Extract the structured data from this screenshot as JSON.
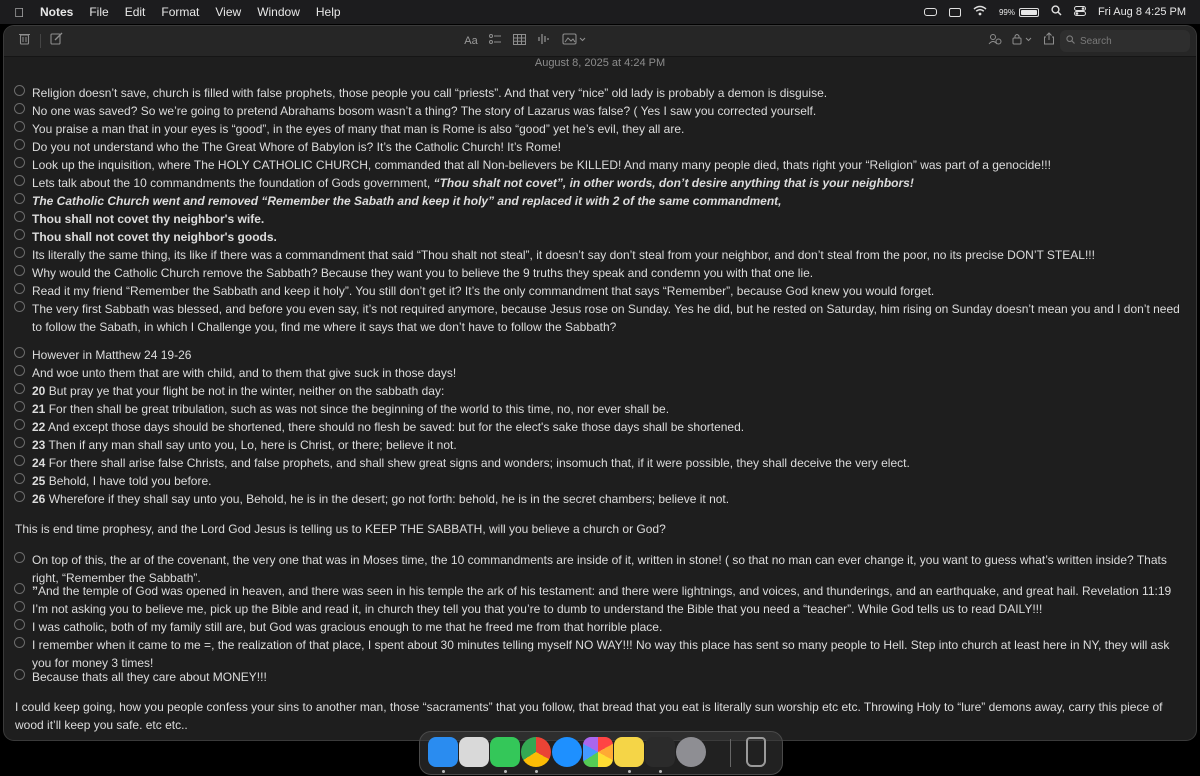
{
  "menubar": {
    "app_name": "Notes",
    "menus": [
      "File",
      "Edit",
      "Format",
      "View",
      "Window",
      "Help"
    ],
    "battery": "99%",
    "battery_level": 0.99,
    "datetime": "Fri Aug 8  4:25 PM",
    "icons": [
      "apple-icon",
      "mirror-icon",
      "screen-icon",
      "wifi-icon",
      "battery-icon",
      "spotlight-icon",
      "control-center-icon"
    ]
  },
  "toolbar": {
    "icons_left": [
      "trash-icon",
      "compose-icon"
    ],
    "icons_center": [
      "format-text-icon",
      "checklist-icon",
      "table-icon",
      "audio-icon",
      "media-icon"
    ],
    "icons_right": [
      "collaborate-icon",
      "lock-icon",
      "share-icon"
    ],
    "format_label": "Aa",
    "search_placeholder": "Search"
  },
  "note": {
    "date": "August 8, 2025 at 4:24 PM",
    "group1": [
      "Religion doesn’t save, church is filled with false prophets, those people you call “priests”. And that very “nice” old lady is probably a demon is disguise.",
      "No one was saved? So we’re going to pretend Abrahams bosom wasn’t a thing? The story of Lazarus was false? ( Yes I saw you corrected yourself.",
      "You praise a man that in your eyes is “good”, in the eyes of many that man is Rome is also “good” yet he’s evil, they all are.",
      "Do you not understand who the The Great Whore of Babylon is? It’s the Catholic Church! It’s Rome!",
      "Look up the inquisition, where The HOLY CATHOLIC CHURCH, commanded that all Non-believers be KILLED! And many many people died, thats right your “Religion” was part of a genocide!!!",
      {
        "plain": "Lets talk about the 10 commandments the foundation of Gods government, ",
        "emph": "“Thou shalt not covet”, in other words, don’t desire anything that is your neighbors!"
      },
      {
        "emph": "The Catholic Church went and removed “Remember the Sabath and keep it holy” and replaced it with 2 of the same commandment,"
      },
      {
        "bold": "Thou shall not covet thy neighbor's wife."
      },
      {
        "bold": "Thou shall not covet thy neighbor's goods."
      },
      "Its literally the same thing, its like if there was a commandment that said “Thou shalt not steal”, it doesn’t say don’t steal from your neighbor, and don’t steal from the poor, no its precise DON’T STEAL!!!",
      "Why would the Catholic Church remove the Sabbath? Because they want you to believe the 9 truths they speak and condemn you with that one lie.",
      "Read it my friend “Remember the Sabbath and keep it holy”. You still don’t get it? It’s the only commandment that says “Remember”, because God knew you would forget.",
      "The very first Sabbath was blessed, and before you even say, it’s not required anymore, because Jesus rose on Sunday. Yes he did, but he rested on Saturday, him rising on Sunday doesn’t mean you and I don’t need to follow the Sabath, in which I Challenge you, find me where it says that we don’t have to follow the Sabbath?"
    ],
    "group2": [
      {
        "text": "However in Matthew 24 19-26"
      },
      {
        "text": "And woe unto them that are with child, and to them that give suck in those days!"
      },
      {
        "num": "20",
        "text": " But pray ye that your flight be not in the winter, neither on the sabbath day:"
      },
      {
        "num": "21",
        "text": " For then shall be great tribulation, such as was not since the beginning of the world to this time, no, nor ever shall be."
      },
      {
        "num": "22",
        "text": " And except those days should be shortened, there should no flesh be saved: but for the elect's sake those days shall be shortened."
      },
      {
        "num": "23",
        "text": " Then if any man shall say unto you, Lo, here is Christ, or there; believe it not."
      },
      {
        "num": "24",
        "text": " For there shall arise false Christs, and false prophets, and shall shew great signs and wonders; insomuch that, if it were possible, they shall deceive the very elect."
      },
      {
        "num": "25",
        "text": " Behold, I have told you before."
      },
      {
        "num": "26",
        "text": " Wherefore if they shall say unto you, Behold, he is in the desert; go not forth: behold, he is in the secret chambers; believe it not."
      }
    ],
    "para1": "This is end time prophesy, and the Lord God Jesus is telling us to KEEP THE SABBATH, will you believe a church or God?",
    "group3": [
      {
        "text": "On top of this, the ar of the covenant, the very one that was in Moses time, the 10 commandments are inside of it, written in stone! ( so that no man can ever change it, you want to guess what’s written inside? Thats right, “Remember the Sabbath”."
      },
      {
        "num": "”",
        "text": "And the temple of God was opened in heaven, and there was seen in his temple the ark of his testament: and there were lightnings, and voices, and thunderings, and an earthquake, and great hail. Revelation 11:19"
      },
      {
        "text": "I’m not asking you to believe me, pick up the Bible and read it, in church they tell you that you’re to dumb to understand the Bible that you need a “teacher”. While God tells us to read DAILY!!!"
      },
      {
        "text": "I was catholic, both of my family still are, but God was gracious enough to me that he freed me from that horrible place."
      },
      {
        "text": "I remember when it came to me =, the realization of that place, I spent about 30 minutes telling myself NO WAY!!! No way this place has sent so many people to Hell. Step into church at least here in NY, they will ask you for money 3 times!"
      },
      {
        "text": "Because thats all they care about MONEY!!!"
      }
    ],
    "para2": "I could keep going, how you people confess your sins to another man, those “sacraments” that you follow, that bread that you eat is literally sun worship etc etc. Throwing Holy to “lure” demons away, carry this piece of wood it’ll keep you safe. etc etc.."
  },
  "dock": {
    "apps": [
      {
        "icon": "finder-icon",
        "color": "#2a8cf0",
        "running": true
      },
      {
        "icon": "launchpad-icon",
        "color": "#d9d9d9",
        "running": false
      },
      {
        "icon": "messages-icon",
        "color": "#34c759",
        "running": true
      },
      {
        "icon": "chrome-icon",
        "color": "#e8e8e8",
        "running": true
      },
      {
        "icon": "safari-icon",
        "color": "#1e90ff",
        "running": false
      },
      {
        "icon": "photos-icon",
        "color": "#f2f2f2",
        "running": false
      },
      {
        "icon": "notes-icon",
        "color": "#f5d547",
        "running": true
      },
      {
        "icon": "iphone-mirroring-icon",
        "color": "#2b2b2b",
        "running": true
      },
      {
        "icon": "system-settings-icon",
        "color": "#8e8e93",
        "running": false
      },
      {
        "icon": "trash-icon",
        "color": "#9a9a9a",
        "running": false
      }
    ]
  }
}
